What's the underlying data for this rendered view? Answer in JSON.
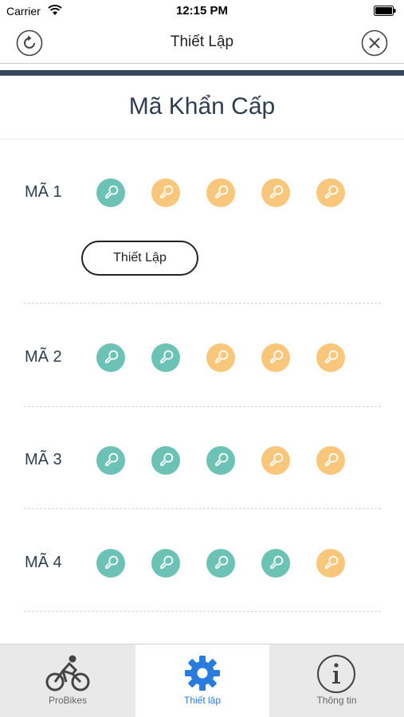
{
  "status_bar": {
    "carrier": "Carrier",
    "time": "12:15 PM"
  },
  "nav": {
    "title": "Thiết Lập"
  },
  "page": {
    "title": "Mã Khẩn Cấp"
  },
  "codes": [
    {
      "label": "MÃ 1",
      "states": [
        "teal",
        "orange",
        "orange",
        "orange",
        "orange"
      ]
    },
    {
      "label": "MÃ 2",
      "states": [
        "teal",
        "teal",
        "orange",
        "orange",
        "orange"
      ]
    },
    {
      "label": "MÃ 3",
      "states": [
        "teal",
        "teal",
        "teal",
        "orange",
        "orange"
      ]
    },
    {
      "label": "MÃ 4",
      "states": [
        "teal",
        "teal",
        "teal",
        "teal",
        "orange"
      ]
    }
  ],
  "setup_button": {
    "label": "Thiết Lập"
  },
  "tabs": [
    {
      "label": "ProBikes",
      "icon": "bicycle-icon",
      "active": false
    },
    {
      "label": "Thiết lập",
      "icon": "gear-icon",
      "active": true
    },
    {
      "label": "Thông tin",
      "icon": "info-icon",
      "active": false
    }
  ],
  "colors": {
    "teal": "#6cc3b5",
    "orange": "#f9c77c",
    "accent": "#2a7bde",
    "header_bar": "#34495e"
  }
}
